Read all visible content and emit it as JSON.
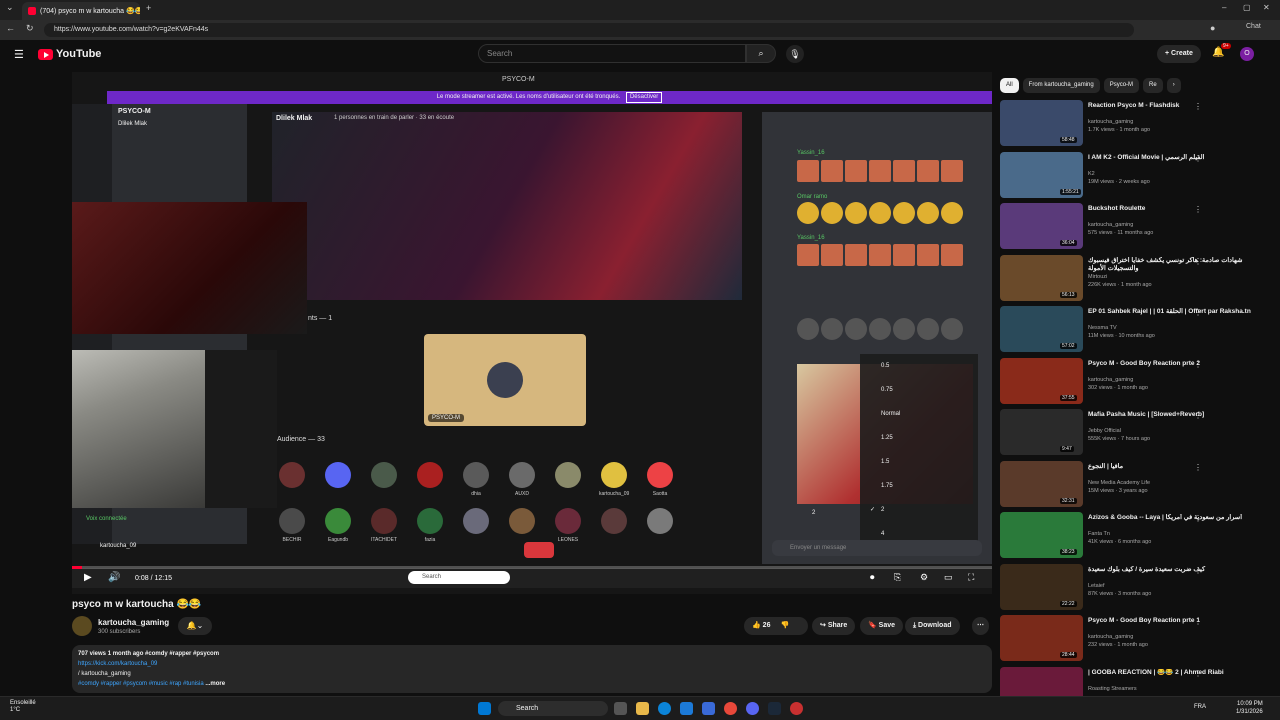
{
  "browser": {
    "tab_title": "(704) psyco m w kartoucha 😂😂",
    "url": "https://www.youtube.com/watch?v=g2eKVAFn44s",
    "chat_label": "Chat"
  },
  "youtube": {
    "logo": "YouTube",
    "search_placeholder": "Search",
    "create_label": "Create",
    "notif_count": "9+",
    "avatar_letter": "O"
  },
  "video": {
    "window_title": "PSYCO-M",
    "streamer_banner": "Le mode streamer est activé. Les noms d'utilisateur ont été tronqués.",
    "streamer_deactivate": "Désactiver",
    "server_name": "PSYCO-M",
    "voice_channel": "Dlilek Mlak",
    "channel_header": "Dlilek Mlak",
    "participants_info": "1 personnes en train de parler · 33 en écoute",
    "speakers_label": "nts — 1",
    "speaker_tile_name": "PSYCO-M",
    "audience_label": "Audience — 33",
    "audience_row1": [
      "",
      "",
      "",
      "",
      "dhia",
      "AUXD",
      "",
      "kartoucha_09",
      "Saotta",
      "KASHI"
    ],
    "audience_row2": [
      "BECHIR",
      "Eagundb",
      "ITACHIDET",
      "fazia",
      "",
      "",
      "LEONES",
      "",
      "",
      ""
    ],
    "voice_connected": "Voix connectée",
    "voice_user": "kartoucha_09",
    "chat_users": [
      "Yassin_16",
      "Omar ramo",
      "Yassin_16"
    ],
    "chat_input_placeholder": "Envoyer un message",
    "reaction_count": "2",
    "speed_options": [
      "0.5",
      "0.75",
      "Normal",
      "1.25",
      "1.5",
      "1.75",
      "2",
      "4"
    ],
    "speed_selected": "2",
    "taskbar_search": "Search",
    "time_current": "0:08",
    "time_total": "12:15",
    "time_display": "0:08 / 12:15",
    "progress_fraction": 0.011
  },
  "meta": {
    "title": "psyco m w kartoucha 😂😂",
    "channel": "kartoucha_gaming",
    "subscribers": "300 subscribers",
    "likes": "26",
    "share": "Share",
    "save": "Save",
    "download": "Download"
  },
  "description": {
    "stats": "707 views  1 month ago  #comdy #rapper #psycom",
    "link": "https://kick.com/kartoucha_09",
    "line3": "/ kartoucha_gaming",
    "tags": "#comdy #rapper #psycom #music #rap #tunisia",
    "more": "...more"
  },
  "chips": [
    "All",
    "From kartoucha_gaming",
    "Psyco-M",
    "Re"
  ],
  "recommendations": [
    {
      "title": "Reaction Psyco M - Flashdisk",
      "channel": "kartoucha_gaming",
      "meta": "1.7K views · 1 month ago",
      "duration": "58:48",
      "color": "#3a4a6a"
    },
    {
      "title": "I AM K2 - Official Movie | الفيلم الرسمي",
      "channel": "K2",
      "meta": "19M views · 2 weeks ago",
      "duration": "1:55:21",
      "color": "#4a6a8a"
    },
    {
      "title": "Buckshot Roulette",
      "channel": "kartoucha_gaming",
      "meta": "575 views · 11 months ago",
      "duration": "36:04",
      "color": "#5a3a7a"
    },
    {
      "title": "شهادات صادمة: هاكر تونسي يكشف خفايا اختراق فيسبوك والتسجيلات الأمولة",
      "channel": "Mirtouzi",
      "meta": "226K views · 1 month ago",
      "duration": "56:13",
      "color": "#6a4a2a"
    },
    {
      "title": "EP 01 Sahbek Rajel | | الحلقة 01 | Offert par Raksha.tn",
      "channel": "Nessma TV",
      "meta": "11M views · 10 months ago",
      "duration": "57:02",
      "color": "#2a4a5a"
    },
    {
      "title": "Psyco M - Good Boy Reaction prte 2",
      "channel": "kartoucha_gaming",
      "meta": "302 views · 1 month ago",
      "duration": "37:55",
      "color": "#8a2a1a"
    },
    {
      "title": "Mafia Pasha Music | [Slowed+Reverb]",
      "channel": "Jebby Official",
      "meta": "555K views · 7 hours ago",
      "duration": "9:47",
      "color": "#2a2a2a"
    },
    {
      "title": "مافيا | النجوع",
      "channel": "New Media Academy Life",
      "meta": "15M views · 3 years ago",
      "duration": "32:31",
      "color": "#5a3a2a"
    },
    {
      "title": "Azizos & Gooba -- Laya | أسرار من سعودية في أمريكا",
      "channel": "Fanta Tn",
      "meta": "41K views · 6 months ago",
      "duration": "38:23",
      "color": "#2a7a3a"
    },
    {
      "title": "كيف ضربت سعيدة سيرة / كيف بلوك سعيدة",
      "channel": "Letaief",
      "meta": "87K views · 3 months ago",
      "duration": "22:22",
      "color": "#3a2a1a"
    },
    {
      "title": "Psyco M - Good Boy Reaction prte 1",
      "channel": "kartoucha_gaming",
      "meta": "232 views · 1 month ago",
      "duration": "28:44",
      "color": "#7a2a1a"
    },
    {
      "title": "| GOOBA REACTION | 😂😂 2 | Ahmed Riabi",
      "channel": "Roasting Streamers",
      "meta": "",
      "duration": "",
      "color": "#6a1a3a"
    }
  ],
  "taskbar": {
    "weather_label": "Ensoleillé",
    "weather_temp": "1°C",
    "search": "Search",
    "lang": "FRA",
    "time": "10:09 PM",
    "date": "1/31/2026"
  }
}
